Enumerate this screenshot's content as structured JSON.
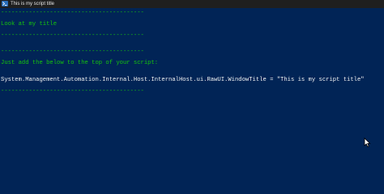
{
  "window": {
    "title": "This is my script title",
    "icon": "powershell-icon"
  },
  "console": {
    "lines": [
      "-----------------------------------------",
      "Look at my title",
      "-----------------------------------------",
      "-----------------------------------------",
      "Just add the below to the top of your script:",
      "System.Management.Automation.Internal.Host.InternalHost.ui.RawUI.WindowTitle = \"This is my script title\"",
      "-----------------------------------------"
    ]
  },
  "colors": {
    "background": "#012456",
    "green_text": "#16c60c",
    "white_text": "#f2f2f2"
  }
}
